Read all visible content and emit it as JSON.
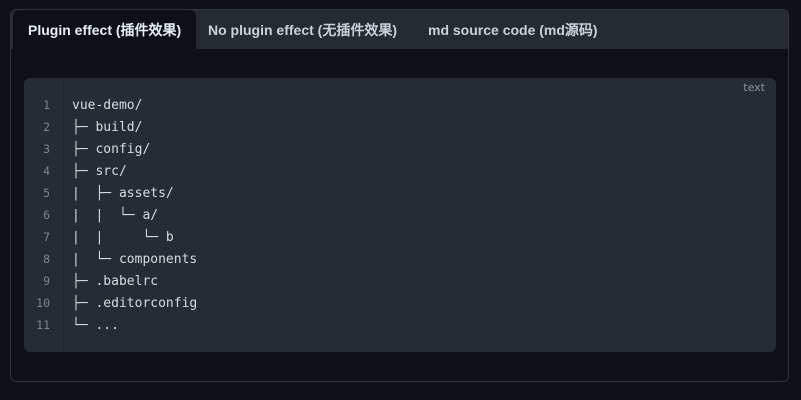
{
  "tabs": [
    {
      "label": "Plugin effect (插件效果)",
      "active": true
    },
    {
      "label": "No plugin effect (无插件效果)",
      "active": false
    },
    {
      "label": "md source code (md源码)",
      "active": false
    }
  ],
  "code": {
    "language": "text",
    "lines": [
      {
        "num": "1",
        "text": "vue-demo/"
      },
      {
        "num": "2",
        "text": "├─ build/"
      },
      {
        "num": "3",
        "text": "├─ config/"
      },
      {
        "num": "4",
        "text": "├─ src/"
      },
      {
        "num": "5",
        "text": "|  ├─ assets/"
      },
      {
        "num": "6",
        "text": "|  |  └─ a/"
      },
      {
        "num": "7",
        "text": "|  |     └─ b"
      },
      {
        "num": "8",
        "text": "|  └─ components"
      },
      {
        "num": "9",
        "text": "├─ .babelrc"
      },
      {
        "num": "10",
        "text": "├─ .editorconfig"
      },
      {
        "num": "11",
        "text": "└─ ..."
      }
    ]
  },
  "colors": {
    "page_bg": "#0d1117",
    "tabbar_bg": "#262a31",
    "code_bg": "#272c34",
    "line_number": "#7d8590",
    "code_text": "#d6dbe1"
  }
}
